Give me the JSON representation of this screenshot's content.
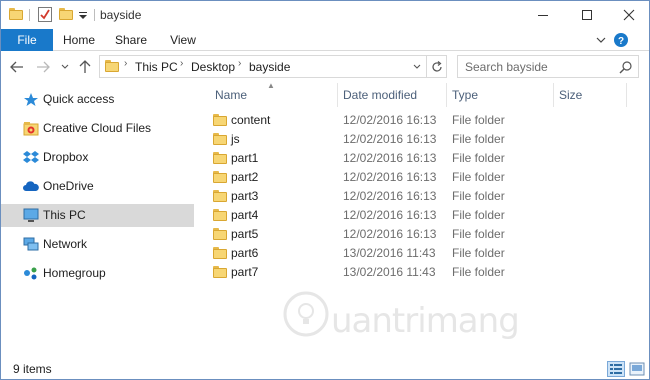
{
  "window": {
    "title": "bayside",
    "controls": {
      "minimize": "minimize",
      "maximize": "maximize",
      "close": "close"
    }
  },
  "ribbon": {
    "tabs": [
      {
        "label": "File"
      },
      {
        "label": "Home"
      },
      {
        "label": "Share"
      },
      {
        "label": "View"
      }
    ]
  },
  "address": {
    "crumbs": [
      "This PC",
      "Desktop",
      "bayside"
    ]
  },
  "search": {
    "placeholder": "Search bayside"
  },
  "navpane": {
    "items": [
      {
        "label": "Quick access",
        "icon": "star-icon"
      },
      {
        "label": "Creative Cloud Files",
        "icon": "creative-cloud-folder-icon"
      },
      {
        "label": "Dropbox",
        "icon": "dropbox-icon"
      },
      {
        "label": "OneDrive",
        "icon": "onedrive-cloud-icon"
      },
      {
        "label": "This PC",
        "icon": "computer-icon",
        "selected": true
      },
      {
        "label": "Network",
        "icon": "network-icon"
      },
      {
        "label": "Homegroup",
        "icon": "homegroup-icon"
      }
    ]
  },
  "filelist": {
    "columns": {
      "name": "Name",
      "date": "Date modified",
      "type": "Type",
      "size": "Size"
    },
    "rows": [
      {
        "name": "content",
        "date": "12/02/2016 16:13",
        "type": "File folder"
      },
      {
        "name": "js",
        "date": "12/02/2016 16:13",
        "type": "File folder"
      },
      {
        "name": "part1",
        "date": "12/02/2016 16:13",
        "type": "File folder"
      },
      {
        "name": "part2",
        "date": "12/02/2016 16:13",
        "type": "File folder"
      },
      {
        "name": "part3",
        "date": "12/02/2016 16:13",
        "type": "File folder"
      },
      {
        "name": "part4",
        "date": "12/02/2016 16:13",
        "type": "File folder"
      },
      {
        "name": "part5",
        "date": "12/02/2016 16:13",
        "type": "File folder"
      },
      {
        "name": "part6",
        "date": "13/02/2016 11:43",
        "type": "File folder"
      },
      {
        "name": "part7",
        "date": "13/02/2016 11:43",
        "type": "File folder"
      }
    ]
  },
  "status": {
    "item_count": "9 items"
  },
  "watermark": {
    "text": "uantrimang"
  },
  "colors": {
    "accent": "#1979ca",
    "selection": "#d9d9d9",
    "folder": "#f7d674"
  }
}
